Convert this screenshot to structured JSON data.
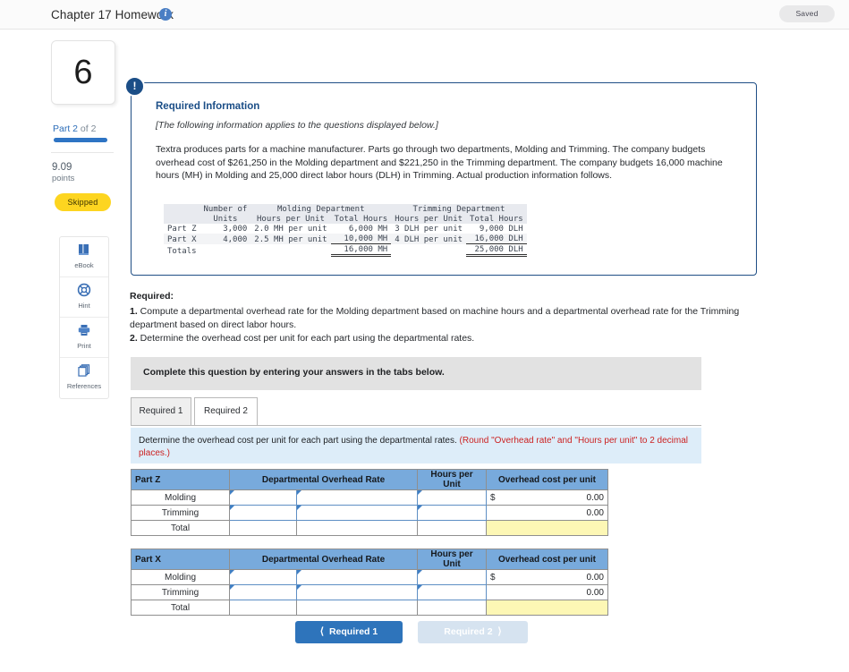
{
  "topbar": {
    "title": "Chapter 17 Homework",
    "info_icon": "info-icon",
    "saved_label": "Saved"
  },
  "rail": {
    "question_number": "6",
    "part_label_main": "Part 2",
    "part_label_of": " of 2",
    "progress_percent": 100,
    "points_value": "9.09",
    "points_word": "points",
    "status_badge": "Skipped",
    "tools": [
      {
        "icon": "book-icon",
        "label": "eBook"
      },
      {
        "icon": "lifebuoy-icon",
        "label": "Hint"
      },
      {
        "icon": "printer-icon",
        "label": "Print"
      },
      {
        "icon": "copy-pages-icon",
        "label": "References"
      }
    ]
  },
  "callout": {
    "bang_icon": "exclamation-icon",
    "title": "Required Information",
    "italic_note": "[The following information applies to the questions displayed below.]",
    "body": "Textra produces parts for a machine manufacturer. Parts go through two departments, Molding and Trimming. The company budgets overhead cost of $261,250 in the Molding department and $221,250 in the Trimming department. The company budgets 16,000 machine hours (MH) in Molding and 25,000 direct labor hours (DLH) in Trimming. Actual production information follows."
  },
  "mono_table": {
    "group_headers": [
      "",
      "Number of",
      "Molding Department",
      "Trimming Department"
    ],
    "sub_headers": [
      "",
      "Units",
      "Hours per Unit",
      "Total Hours",
      "Hours per Unit",
      "Total Hours"
    ],
    "rows": [
      {
        "label": "Part Z",
        "units": "3,000",
        "molding_hpu": "2.0 MH per unit",
        "molding_total": "6,000 MH",
        "trimming_hpu": "3 DLH per unit",
        "trimming_total": "9,000 DLH"
      },
      {
        "label": "Part X",
        "units": "4,000",
        "molding_hpu": "2.5 MH per unit",
        "molding_total": "10,000 MH",
        "trimming_hpu": "4 DLH per unit",
        "trimming_total": "16,000 DLH"
      }
    ],
    "totals": {
      "label": "Totals",
      "units": "",
      "molding_hpu": "",
      "molding_total": "16,000 MH",
      "trimming_hpu": "",
      "trimming_total": "25,000 DLH"
    }
  },
  "required": {
    "heading": "Required:",
    "item1_num": "1.",
    "item1_text": " Compute a departmental overhead rate for the Molding department based on machine hours and a departmental overhead rate for the Trimming department based on direct labor hours.",
    "item2_num": "2.",
    "item2_text": " Determine the overhead cost per unit for each part using the departmental rates."
  },
  "complete_bar": {
    "text": "Complete this question by entering your answers in the tabs below."
  },
  "tabs": [
    {
      "label": "Required 1",
      "active": false
    },
    {
      "label": "Required 2",
      "active": true
    }
  ],
  "blue_prompt": {
    "text_main": "Determine the overhead cost per unit for each part using the departmental rates. ",
    "text_red": "(Round \"Overhead rate\" and \"Hours per unit\" to 2 decimal places.)"
  },
  "answer_tables": [
    {
      "part_name": "Part Z",
      "columns": [
        "Departmental Overhead Rate",
        "Hours per Unit",
        "Overhead cost per unit"
      ],
      "rows": [
        {
          "label": "Molding",
          "rate_a": "",
          "rate_b": "",
          "hours": "",
          "dollar": "$",
          "cost": "0.00",
          "inputs": true
        },
        {
          "label": "Trimming",
          "rate_a": "",
          "rate_b": "",
          "hours": "",
          "dollar": "",
          "cost": "0.00",
          "inputs": true
        },
        {
          "label": "Total",
          "rate_a": "",
          "rate_b": "",
          "hours": "",
          "dollar": "",
          "cost": "",
          "inputs": false
        }
      ]
    },
    {
      "part_name": "Part X",
      "columns": [
        "Departmental Overhead Rate",
        "Hours per Unit",
        "Overhead cost per unit"
      ],
      "rows": [
        {
          "label": "Molding",
          "rate_a": "",
          "rate_b": "",
          "hours": "",
          "dollar": "$",
          "cost": "0.00",
          "inputs": true
        },
        {
          "label": "Trimming",
          "rate_a": "",
          "rate_b": "",
          "hours": "",
          "dollar": "",
          "cost": "0.00",
          "inputs": true
        },
        {
          "label": "Total",
          "rate_a": "",
          "rate_b": "",
          "hours": "",
          "dollar": "",
          "cost": "",
          "inputs": false
        }
      ]
    }
  ],
  "nav": {
    "prev_label": "Required 1",
    "prev_chevron": "chevron-left-icon",
    "next_label": "Required 2",
    "next_chevron": "chevron-right-icon"
  },
  "colors": {
    "accent_blue": "#2e74bb",
    "callout_border": "#1f4e85",
    "table_header": "#78aadc",
    "yellow_cell": "#fdf7b5",
    "skipped_badge": "#fdd520",
    "red_note": "#cc2222"
  }
}
